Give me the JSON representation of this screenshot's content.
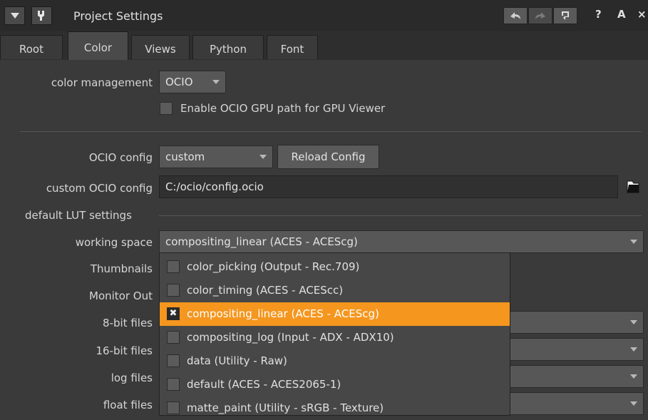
{
  "window": {
    "title": "Project Settings",
    "help_glyph": "?",
    "float_glyph": "Α",
    "close_glyph": "×"
  },
  "tabs": [
    {
      "label": "Root"
    },
    {
      "label": "Color"
    },
    {
      "label": "Views"
    },
    {
      "label": "Python"
    },
    {
      "label": "Font"
    }
  ],
  "color_management": {
    "label": "color management",
    "value": "OCIO"
  },
  "gpu_path": {
    "label": "Enable OCIO GPU path for GPU Viewer"
  },
  "ocio_config": {
    "label": "OCIO config",
    "value": "custom",
    "reload_label": "Reload Config"
  },
  "custom_ocio": {
    "label": "custom OCIO config",
    "value": "C:/ocio/config.ocio"
  },
  "default_lut": {
    "label": "default LUT settings"
  },
  "working_space": {
    "label": "working space",
    "value": "compositing_linear (ACES - ACEScg)"
  },
  "lut_rows": [
    {
      "label": "Thumbnails"
    },
    {
      "label": "Monitor Out"
    },
    {
      "label": "8-bit files"
    },
    {
      "label": "16-bit files"
    },
    {
      "label": "log files"
    },
    {
      "label": "float files"
    }
  ],
  "dropdown": {
    "items": [
      {
        "label": "color_picking (Output - Rec.709)",
        "selected": false
      },
      {
        "label": "color_timing (ACES - ACEScc)",
        "selected": false
      },
      {
        "label": "compositing_linear (ACES - ACEScg)",
        "selected": true
      },
      {
        "label": "compositing_log (Input - ADX - ADX10)",
        "selected": false
      },
      {
        "label": "data (Utility - Raw)",
        "selected": false
      },
      {
        "label": "default (ACES - ACES2065-1)",
        "selected": false
      },
      {
        "label": "matte_paint (Utility - sRGB - Texture)",
        "selected": false
      }
    ],
    "selected_mark": "✖"
  },
  "colors": {
    "accent": "#f5961e",
    "panel": "#3a3a3a",
    "titlebar": "#2a2a2a"
  }
}
